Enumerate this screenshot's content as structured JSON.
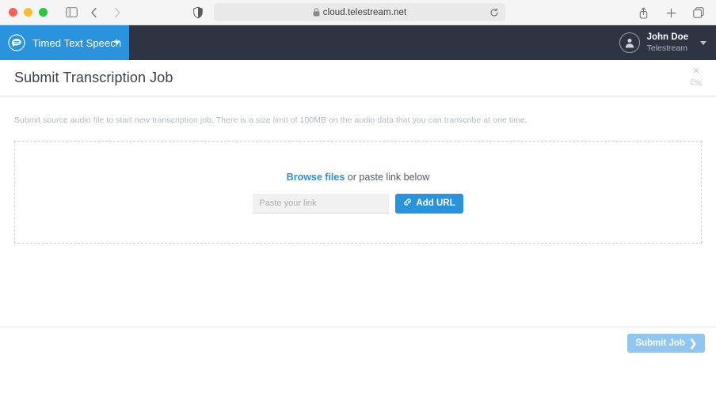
{
  "browser": {
    "traffic_lights": [
      "close",
      "minimize",
      "maximize"
    ],
    "sidebar_icon": "sidebar-toggle-icon",
    "back_icon": "back-chevron-icon",
    "forward_icon": "forward-chevron-icon",
    "shield_icon": "privacy-shield-icon",
    "lock_icon": "lock-icon",
    "url": "cloud.telestream.net",
    "reload_icon": "reload-icon",
    "share_icon": "share-icon",
    "new_tab_icon": "plus-icon",
    "tabs_icon": "tabs-overview-icon"
  },
  "navbar": {
    "brand_label": "Timed Text Speech",
    "brand_logo": "speech-bubble-logo",
    "brand_caret": "chevron-down-icon",
    "user": {
      "name": "John Doe",
      "org": "Telestream",
      "avatar_icon": "user-avatar-icon",
      "caret": "chevron-down-icon"
    }
  },
  "page": {
    "title": "Submit Transcription Job",
    "close_symbol": "×",
    "close_label": "Esc",
    "description": "Submit source audio file to start new transcription job. There is a size limit of 100MB on the audio data that you can transcribe at one time."
  },
  "dropzone": {
    "browse_label": "Browse files",
    "prompt_rest": " or paste link below",
    "input_placeholder": "Paste your link",
    "input_value": "",
    "add_url_label": "Add URL",
    "add_url_icon": "link-chain-icon"
  },
  "footer": {
    "submit_label": "Submit Job",
    "submit_icon": "chevron-right-icon"
  },
  "colors": {
    "accent_blue": "#2a93dd",
    "navbar_dark": "#2e3442",
    "submit_disabled": "#90c6ef",
    "dash_border": "#d4d7db"
  }
}
